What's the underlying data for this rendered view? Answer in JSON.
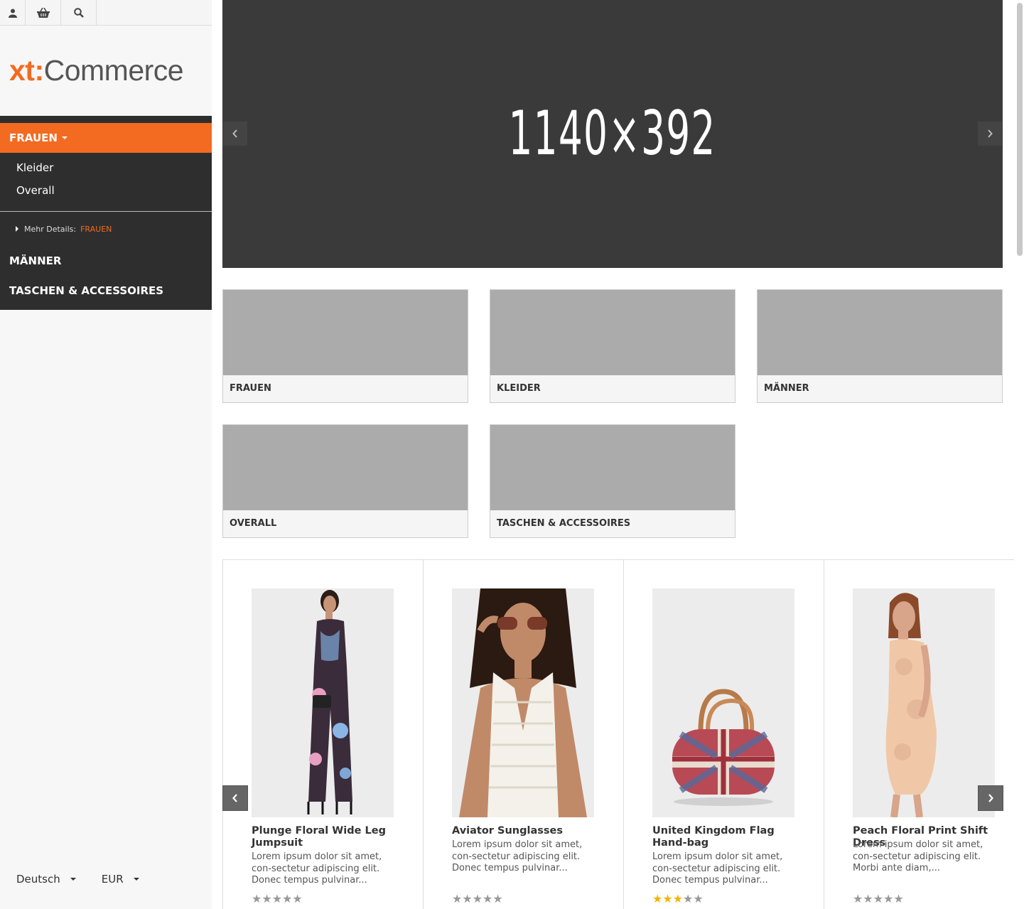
{
  "topbar": {
    "icons": [
      "user-icon",
      "basket-icon",
      "search-icon"
    ]
  },
  "logo": {
    "part1": "xt:",
    "part2": "Commerce"
  },
  "nav": {
    "active": "FRAUEN",
    "sub": [
      "Kleider",
      "Overall"
    ],
    "more_label": "Mehr Details:",
    "more_link": "FRAUEN",
    "categories": [
      "MÄNNER",
      "TASCHEN & ACCESSOIRES"
    ]
  },
  "footer": {
    "language": "Deutsch",
    "currency": "EUR"
  },
  "hero": {
    "text": "1140×392"
  },
  "tiles": [
    {
      "label": "FRAUEN"
    },
    {
      "label": "KLEIDER"
    },
    {
      "label": "MÄNNER"
    },
    {
      "label": "OVERALL"
    },
    {
      "label": "TASCHEN & ACCESSOIRES"
    }
  ],
  "products": [
    {
      "title": "Plunge Floral Wide Leg Jumpsuit",
      "desc": "Lorem ipsum dolor sit amet, con-sectetur adipiscing elit. Donec tempus pulvinar...",
      "rating": 0
    },
    {
      "title": "Aviator Sunglasses",
      "desc": "Lorem ipsum dolor sit amet, con-sectetur adipiscing elit. Donec tempus pulvinar...",
      "rating": 0
    },
    {
      "title": "United Kingdom Flag Hand-bag",
      "desc": "Lorem ipsum dolor sit amet, con-sectetur adipiscing elit. Donec tempus pulvinar...",
      "rating": 3
    },
    {
      "title": "Peach Floral Print Shift Dress",
      "desc": "Lorem ipsum dolor sit amet, con-sectetur adipiscing elit. Morbi ante diam,...",
      "rating": 0
    }
  ],
  "colors": {
    "accent": "#f26b21",
    "nav_bg": "#2e2e2e",
    "hero_bg": "#3a3a3a",
    "tile_img": "#ababab"
  }
}
